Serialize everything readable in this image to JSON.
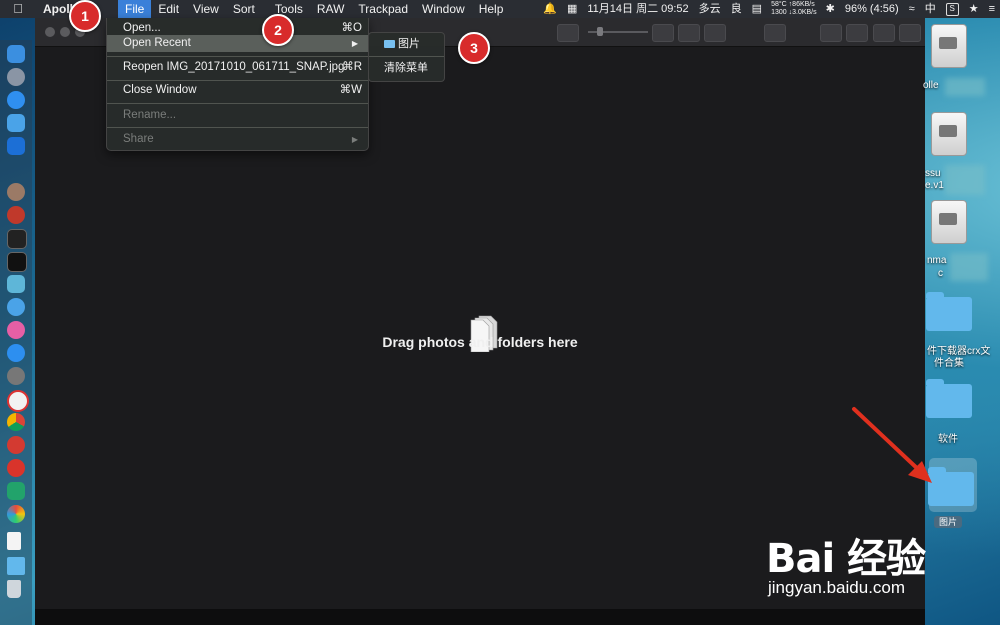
{
  "menubar": {
    "apple": "",
    "app_name": "Apoll",
    "items": [
      "File",
      "Edit",
      "View",
      "Sort",
      "Tools",
      "RAW",
      "Trackpad",
      "Window",
      "Help"
    ],
    "status": {
      "datetime": "11月14日 周二 09:52",
      "weather": "多云",
      "air": "良",
      "net_temp": "58°C",
      "net_up": "↑86KB/s",
      "net_rpm": "1300",
      "net_down": "↓3.0KB/s",
      "battery": "96% (4:56)",
      "input": "中",
      "s_icon": "S"
    }
  },
  "file_menu": {
    "items": [
      {
        "label": "Open...",
        "shortcut": "⌘O"
      },
      {
        "label": "Open Recent",
        "shortcut": "▶"
      },
      {
        "label": "Reopen IMG_20171010_061711_SNAP.jpg",
        "shortcut": "⌘R"
      },
      {
        "label": "Close Window",
        "shortcut": "⌘W"
      },
      {
        "label": "Rename...",
        "shortcut": ""
      },
      {
        "label": "Share",
        "shortcut": "▶"
      }
    ]
  },
  "recent_menu": {
    "items": [
      "图片",
      "清除菜单"
    ]
  },
  "badges": [
    "1",
    "2",
    "3"
  ],
  "main": {
    "drop_text": "Drag photos and folders here"
  },
  "desktop": {
    "labels": [
      "olle",
      "ssu",
      "e.v1",
      "nma",
      "c",
      "件下载器crx文",
      "件合集",
      "软件",
      "图片"
    ]
  },
  "watermark": {
    "main": "Bai 经验",
    "url": "jingyan.baidu.com"
  },
  "colors": {
    "menu_highlight": "#3a80d9",
    "badge": "#d82b2b",
    "arrow": "#e0301e",
    "folder": "#62b8ec"
  }
}
